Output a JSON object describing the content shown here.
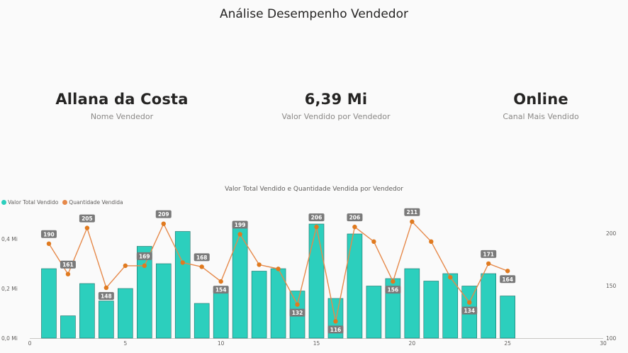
{
  "page": {
    "title": "Análise Desempenho Vendedor"
  },
  "kpis": [
    {
      "value": "Allana da Costa",
      "label": "Nome Vendedor"
    },
    {
      "value": "6,39 Mi",
      "label": "Valor Vendido por Vendedor"
    },
    {
      "value": "Online",
      "label": "Canal Mais Vendido"
    }
  ],
  "colors": {
    "bar": "#2ccfbd",
    "bar_stroke": "#1f6f66",
    "line": "#e6894a",
    "marker": "#e07a1f",
    "label_bg": "#7a7a7a",
    "label_text": "#ffffff"
  },
  "chart_data": {
    "type": "bar",
    "title": "Valor Total Vendido e Quantidade Vendida por Vendedor",
    "legend_position": "top-left",
    "grid": false,
    "x_ticks": [
      "0",
      "5",
      "10",
      "15",
      "20",
      "25",
      "30"
    ],
    "xlim": [
      0,
      30
    ],
    "y_left": {
      "ticks": [
        "0,0 Mi",
        "0,2 Mi",
        "0,4 Mi"
      ],
      "tick_values": [
        0,
        0.2,
        0.4
      ],
      "lim": [
        0,
        0.4
      ]
    },
    "y_right": {
      "ticks": [
        "100",
        "150",
        "200"
      ],
      "tick_values": [
        100,
        150,
        200
      ],
      "lim": [
        100,
        200
      ]
    },
    "x": [
      1,
      2,
      3,
      4,
      5,
      6,
      7,
      8,
      9,
      10,
      11,
      12,
      13,
      14,
      15,
      16,
      17,
      18,
      19,
      20,
      21,
      22,
      23,
      24,
      25
    ],
    "series": [
      {
        "name": "Valor Total Vendido",
        "kind": "bar",
        "axis": "left",
        "values": [
          0.28,
          0.09,
          0.22,
          0.15,
          0.2,
          0.37,
          0.3,
          0.43,
          0.14,
          0.19,
          0.46,
          0.27,
          0.28,
          0.19,
          0.46,
          0.16,
          0.42,
          0.21,
          0.24,
          0.28,
          0.23,
          0.26,
          0.21,
          0.26,
          0.17
        ]
      },
      {
        "name": "Quantidade Vendida",
        "kind": "line",
        "axis": "right",
        "values": [
          190,
          161,
          205,
          148,
          169,
          169,
          209,
          172,
          168,
          154,
          199,
          170,
          166,
          132,
          206,
          116,
          206,
          192,
          154,
          211,
          192,
          158,
          134,
          171,
          164
        ],
        "data_labels": [
          {
            "index": 0,
            "text": "190"
          },
          {
            "index": 1,
            "text": "161"
          },
          {
            "index": 2,
            "text": "205"
          },
          {
            "index": 3,
            "text": "148"
          },
          {
            "index": 5,
            "text": "169"
          },
          {
            "index": 6,
            "text": "209"
          },
          {
            "index": 8,
            "text": "168"
          },
          {
            "index": 9,
            "text": "154"
          },
          {
            "index": 10,
            "text": "199"
          },
          {
            "index": 13,
            "text": "132"
          },
          {
            "index": 14,
            "text": "206"
          },
          {
            "index": 15,
            "text": "116"
          },
          {
            "index": 16,
            "text": "206"
          },
          {
            "index": 18,
            "text": "156"
          },
          {
            "index": 19,
            "text": "211"
          },
          {
            "index": 22,
            "text": "134"
          },
          {
            "index": 23,
            "text": "171"
          },
          {
            "index": 24,
            "text": "164"
          }
        ]
      }
    ]
  }
}
